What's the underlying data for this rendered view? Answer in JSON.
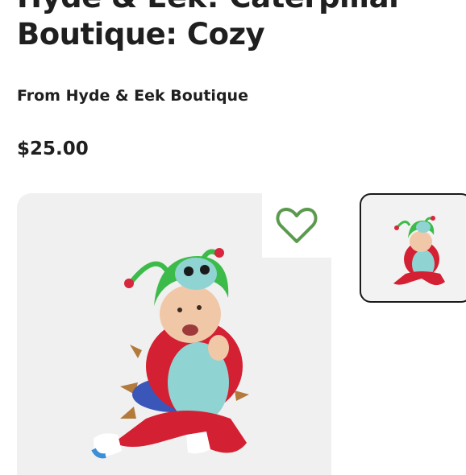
{
  "product": {
    "title_line_1": "Hyde & Eek! Caterpillar",
    "title_line_2": "Boutique: Cozy",
    "brand_text": "From Hyde & Eek Boutique",
    "price": "$25.00"
  },
  "gallery": {
    "main_image_alt": "Baby in a green and red caterpillar costume",
    "thumbnail_alt": "Caterpillar costume thumbnail",
    "like_icon": "heart-icon",
    "like_color": "#5b9a4e"
  }
}
